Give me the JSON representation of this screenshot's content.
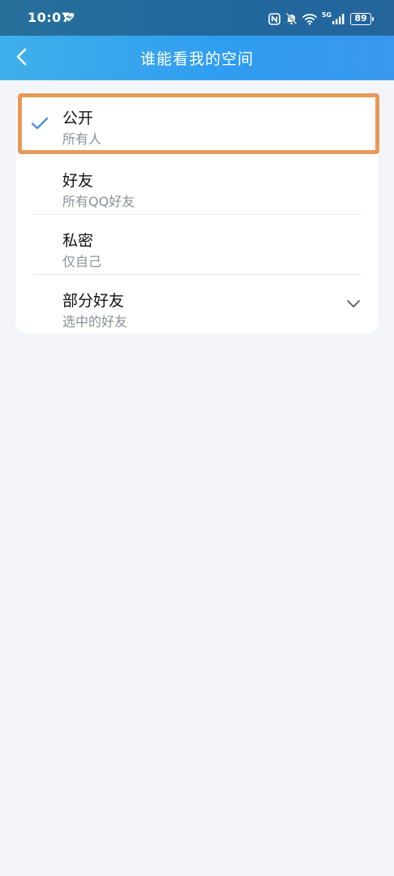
{
  "status_bar": {
    "time": "10:07",
    "battery": "89",
    "network": "5G"
  },
  "header": {
    "title": "谁能看我的空间"
  },
  "options": [
    {
      "title": "公开",
      "subtitle": "所有人",
      "selected": true
    },
    {
      "title": "好友",
      "subtitle": "所有QQ好友",
      "selected": false
    },
    {
      "title": "私密",
      "subtitle": "仅自己",
      "selected": false
    },
    {
      "title": "部分好友",
      "subtitle": "选中的好友",
      "selected": false,
      "expandable": true
    }
  ],
  "colors": {
    "header_start": "#3fb0ea",
    "header_end": "#3a98ee",
    "check": "#4a8fe6",
    "highlight": "#e69a5a",
    "background": "#f4f5fa"
  },
  "icons": {
    "back": "chevron-left-icon",
    "check": "check-icon",
    "expand": "chevron-down-icon"
  }
}
